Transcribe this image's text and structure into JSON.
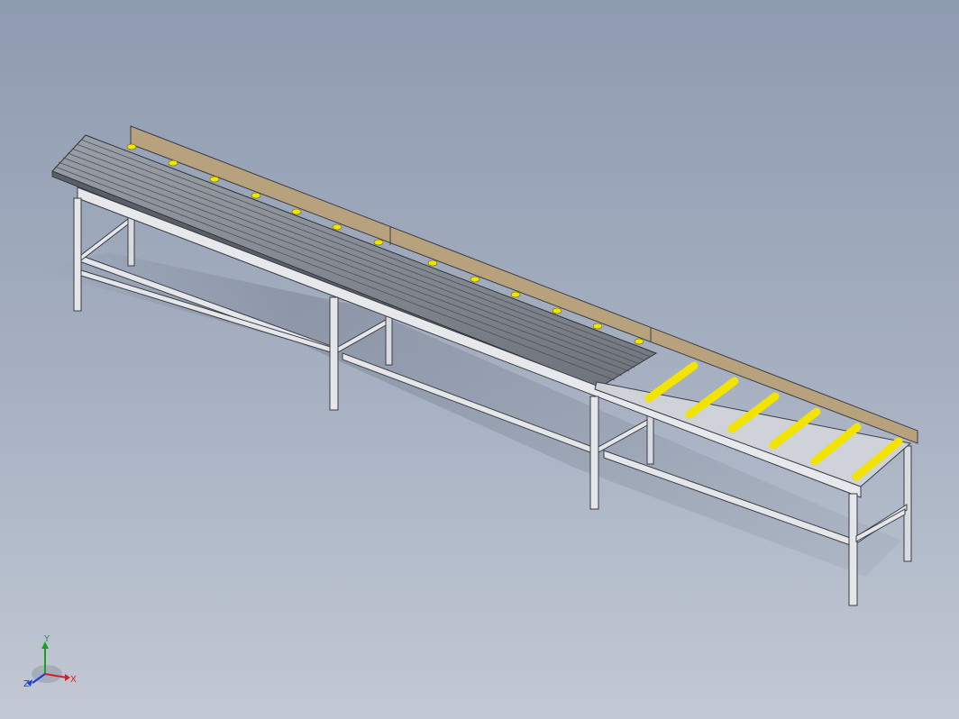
{
  "view": {
    "type": "3d-cad-model-viewport",
    "background_colors": [
      "#8e9bb0",
      "#c2c9d4"
    ]
  },
  "model": {
    "frame_color": "#d8dbe0",
    "frame_edge_color": "#3a3d44",
    "roller_color": "#f2e400",
    "backplate_color": "#b8a27e",
    "belt_color": "#8a8f97"
  },
  "triad": {
    "x_label": "X",
    "y_label": "Y",
    "z_label": "Z",
    "x_color": "#d0202a",
    "y_color": "#1aa020",
    "z_color": "#1a3ad0"
  }
}
